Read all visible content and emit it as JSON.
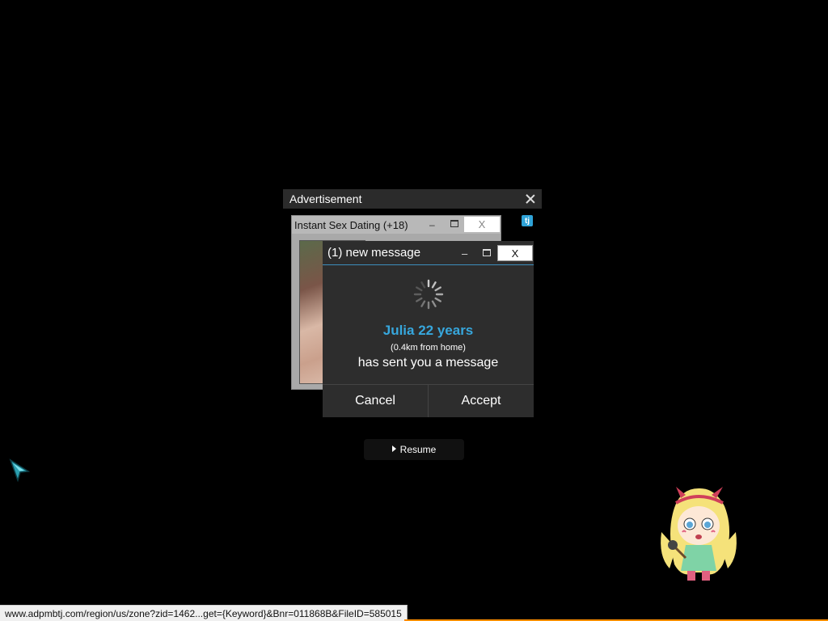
{
  "ad_frame": {
    "title": "Advertisement"
  },
  "background_window": {
    "title": "Instant Sex Dating (+18)",
    "close_label": "X"
  },
  "tj_icon": "tj",
  "message_window": {
    "title": "(1) new message",
    "close_label": "X",
    "sender": "Julia 22 years",
    "distance": "(0.4km from home)",
    "text": "has sent you a message",
    "cancel_label": "Cancel",
    "accept_label": "Accept",
    "accent_color": "#37a7dd"
  },
  "resume_button": {
    "label": "Resume"
  },
  "status_bar": {
    "url": "www.adpmbtj.com/region/us/zone?zid=1462...get={Keyword}&Bnr=011868B&FileID=585015"
  }
}
